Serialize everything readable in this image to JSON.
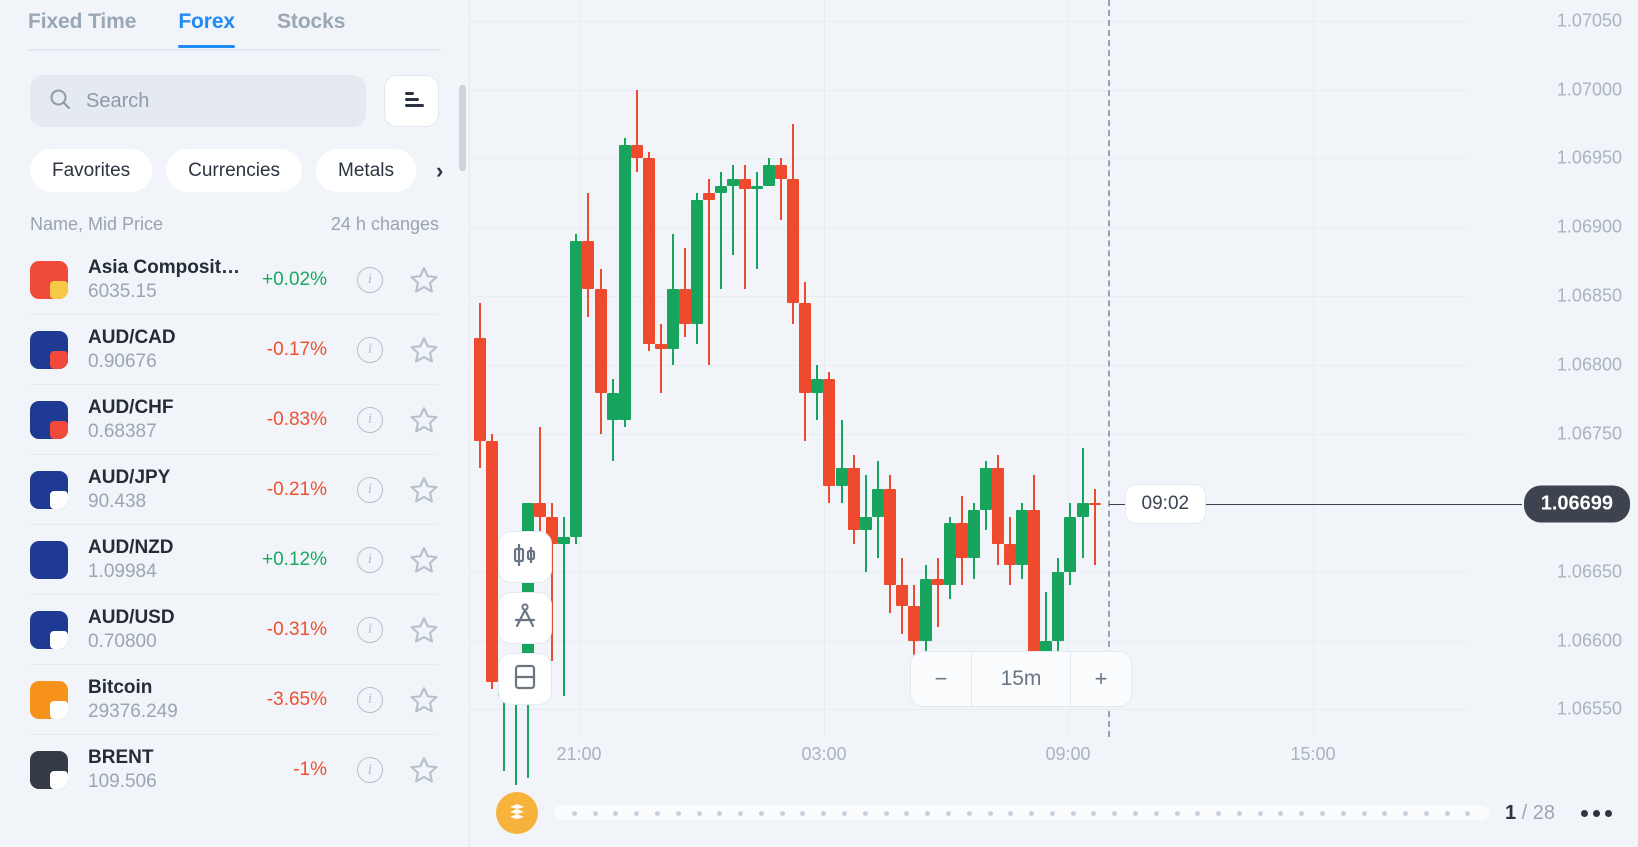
{
  "sidebar": {
    "tabs": [
      {
        "label": "Fixed Time",
        "active": false
      },
      {
        "label": "Forex",
        "active": true
      },
      {
        "label": "Stocks",
        "active": false
      }
    ],
    "search": {
      "placeholder": "Search",
      "value": ""
    },
    "filter_button_icon": "sort-icon",
    "chips": [
      "Favorites",
      "Currencies",
      "Metals"
    ],
    "chips_next_glyph": "›",
    "list_header": {
      "left": "Name, Mid Price",
      "right": "24 h changes"
    },
    "assets": [
      {
        "name": "Asia Composite In...",
        "price": "6035.15",
        "change": "+0.02%",
        "dir": "up",
        "icon": "flag-asean",
        "c1": "#ef4a3c",
        "c2": "#f7c948"
      },
      {
        "name": "AUD/CAD",
        "price": "0.90676",
        "change": "-0.17%",
        "dir": "down",
        "icon": "flag-aud-cad",
        "c1": "#1f3a93",
        "c2": "#ef4a3c"
      },
      {
        "name": "AUD/CHF",
        "price": "0.68387",
        "change": "-0.83%",
        "dir": "down",
        "icon": "flag-aud-chf",
        "c1": "#1f3a93",
        "c2": "#ef4a3c"
      },
      {
        "name": "AUD/JPY",
        "price": "90.438",
        "change": "-0.21%",
        "dir": "down",
        "icon": "flag-aud-jpy",
        "c1": "#1f3a93",
        "c2": "#ffffff"
      },
      {
        "name": "AUD/NZD",
        "price": "1.09984",
        "change": "+0.12%",
        "dir": "up",
        "icon": "flag-aud-nzd",
        "c1": "#1f3a93",
        "c2": "#1f3a93"
      },
      {
        "name": "AUD/USD",
        "price": "0.70800",
        "change": "-0.31%",
        "dir": "down",
        "icon": "flag-aud-usd",
        "c1": "#1f3a93",
        "c2": "#ffffff"
      },
      {
        "name": "Bitcoin",
        "price": "29376.249",
        "change": "-3.65%",
        "dir": "down",
        "icon": "bitcoin-icon",
        "c1": "#f7931a",
        "c2": "#ffffff"
      },
      {
        "name": "BRENT",
        "price": "109.506",
        "change": "-1%",
        "dir": "down",
        "icon": "oil-drop-icon",
        "c1": "#343a46",
        "c2": "#ffffff"
      }
    ],
    "info_glyph": "i",
    "star_icon": "star-outline-icon"
  },
  "chart": {
    "toolbar": [
      {
        "name": "candlestick-type-button",
        "icon": "candlestick-icon"
      },
      {
        "name": "drawing-tools-button",
        "icon": "compass-icon"
      },
      {
        "name": "indicators-button",
        "icon": "panel-split-icon"
      }
    ],
    "timeframe": {
      "minus": "−",
      "value": "15m",
      "plus": "+"
    },
    "crosshair_time": "09:02",
    "current_price": "1.06699",
    "y_axis_labels": [
      "1.07050",
      "1.07000",
      "1.06950",
      "1.06900",
      "1.06850",
      "1.06800",
      "1.06750",
      "1.06650",
      "1.06600",
      "1.06550"
    ],
    "x_axis_labels": [
      "21:00",
      "03:00",
      "09:00",
      "15:00"
    ],
    "pagination": {
      "current": "1",
      "separator": "/",
      "total": "28"
    },
    "more_icon": "more-dots-icon",
    "logo_icon": "brand-logo-icon",
    "colors": {
      "up": "#17a55e",
      "down": "#ef4a2e",
      "accent": "#1f8cf5",
      "tag_bg": "#3d434f",
      "brand": "#f7b23b"
    }
  },
  "chart_data": {
    "type": "candlestick",
    "title": "",
    "xlabel": "",
    "ylabel": "",
    "ylim": [
      1.0653,
      1.07065
    ],
    "xticks": [
      "21:00",
      "03:00",
      "09:00",
      "15:00"
    ],
    "yticks": [
      1.0705,
      1.07,
      1.0695,
      1.069,
      1.0685,
      1.068,
      1.0675,
      1.0665,
      1.066,
      1.0655
    ],
    "grid": true,
    "legend": "none",
    "current_price": 1.06699,
    "crosshair_time": "09:02",
    "candles": [
      {
        "o": 1.0682,
        "h": 1.06845,
        "l": 1.06725,
        "c": 1.06745,
        "d": "down"
      },
      {
        "o": 1.06745,
        "h": 1.0675,
        "l": 1.06565,
        "c": 1.0657,
        "d": "down"
      },
      {
        "o": 1.06565,
        "h": 1.06575,
        "l": 1.06505,
        "c": 1.0656,
        "d": "up"
      },
      {
        "o": 1.0656,
        "h": 1.0658,
        "l": 1.06495,
        "c": 1.06572,
        "d": "up"
      },
      {
        "o": 1.06572,
        "h": 1.067,
        "l": 1.065,
        "c": 1.067,
        "d": "up"
      },
      {
        "o": 1.067,
        "h": 1.06755,
        "l": 1.06665,
        "c": 1.0669,
        "d": "down"
      },
      {
        "o": 1.0669,
        "h": 1.067,
        "l": 1.06585,
        "c": 1.0667,
        "d": "down"
      },
      {
        "o": 1.0667,
        "h": 1.0669,
        "l": 1.0656,
        "c": 1.06675,
        "d": "up"
      },
      {
        "o": 1.06675,
        "h": 1.06895,
        "l": 1.0667,
        "c": 1.0689,
        "d": "up"
      },
      {
        "o": 1.0689,
        "h": 1.06925,
        "l": 1.06835,
        "c": 1.06855,
        "d": "down"
      },
      {
        "o": 1.06855,
        "h": 1.0687,
        "l": 1.0675,
        "c": 1.0678,
        "d": "down"
      },
      {
        "o": 1.0678,
        "h": 1.0679,
        "l": 1.0673,
        "c": 1.0676,
        "d": "up"
      },
      {
        "o": 1.0676,
        "h": 1.06965,
        "l": 1.06755,
        "c": 1.0696,
        "d": "up"
      },
      {
        "o": 1.0696,
        "h": 1.07,
        "l": 1.0694,
        "c": 1.0695,
        "d": "down"
      },
      {
        "o": 1.0695,
        "h": 1.06955,
        "l": 1.0681,
        "c": 1.06815,
        "d": "down"
      },
      {
        "o": 1.06815,
        "h": 1.0683,
        "l": 1.0678,
        "c": 1.06812,
        "d": "down"
      },
      {
        "o": 1.06812,
        "h": 1.06895,
        "l": 1.068,
        "c": 1.06855,
        "d": "up"
      },
      {
        "o": 1.06855,
        "h": 1.06885,
        "l": 1.0682,
        "c": 1.0683,
        "d": "down"
      },
      {
        "o": 1.0683,
        "h": 1.06925,
        "l": 1.06815,
        "c": 1.0692,
        "d": "up"
      },
      {
        "o": 1.0692,
        "h": 1.06935,
        "l": 1.068,
        "c": 1.06925,
        "d": "down"
      },
      {
        "o": 1.06925,
        "h": 1.0694,
        "l": 1.06855,
        "c": 1.0693,
        "d": "up"
      },
      {
        "o": 1.0693,
        "h": 1.06945,
        "l": 1.0688,
        "c": 1.06935,
        "d": "up"
      },
      {
        "o": 1.06935,
        "h": 1.06945,
        "l": 1.06855,
        "c": 1.06928,
        "d": "down"
      },
      {
        "o": 1.06928,
        "h": 1.0694,
        "l": 1.0687,
        "c": 1.0693,
        "d": "up"
      },
      {
        "o": 1.0693,
        "h": 1.0695,
        "l": 1.0693,
        "c": 1.06945,
        "d": "up"
      },
      {
        "o": 1.06945,
        "h": 1.0695,
        "l": 1.06905,
        "c": 1.06935,
        "d": "down"
      },
      {
        "o": 1.06935,
        "h": 1.06975,
        "l": 1.0683,
        "c": 1.06845,
        "d": "down"
      },
      {
        "o": 1.06845,
        "h": 1.0686,
        "l": 1.06745,
        "c": 1.0678,
        "d": "down"
      },
      {
        "o": 1.0678,
        "h": 1.068,
        "l": 1.0676,
        "c": 1.0679,
        "d": "up"
      },
      {
        "o": 1.0679,
        "h": 1.06795,
        "l": 1.067,
        "c": 1.06712,
        "d": "down"
      },
      {
        "o": 1.06712,
        "h": 1.0676,
        "l": 1.067,
        "c": 1.06725,
        "d": "up"
      },
      {
        "o": 1.06725,
        "h": 1.06735,
        "l": 1.0667,
        "c": 1.0668,
        "d": "down"
      },
      {
        "o": 1.0668,
        "h": 1.0672,
        "l": 1.0665,
        "c": 1.0669,
        "d": "up"
      },
      {
        "o": 1.0669,
        "h": 1.0673,
        "l": 1.0666,
        "c": 1.0671,
        "d": "up"
      },
      {
        "o": 1.0671,
        "h": 1.0672,
        "l": 1.0662,
        "c": 1.0664,
        "d": "down"
      },
      {
        "o": 1.0664,
        "h": 1.0666,
        "l": 1.06605,
        "c": 1.06625,
        "d": "down"
      },
      {
        "o": 1.06625,
        "h": 1.0664,
        "l": 1.0658,
        "c": 1.066,
        "d": "down"
      },
      {
        "o": 1.066,
        "h": 1.06655,
        "l": 1.06585,
        "c": 1.06645,
        "d": "up"
      },
      {
        "o": 1.06645,
        "h": 1.0666,
        "l": 1.0661,
        "c": 1.0664,
        "d": "down"
      },
      {
        "o": 1.0664,
        "h": 1.0669,
        "l": 1.0663,
        "c": 1.06685,
        "d": "up"
      },
      {
        "o": 1.06685,
        "h": 1.06705,
        "l": 1.0664,
        "c": 1.0666,
        "d": "down"
      },
      {
        "o": 1.0666,
        "h": 1.067,
        "l": 1.06645,
        "c": 1.06695,
        "d": "up"
      },
      {
        "o": 1.06695,
        "h": 1.0673,
        "l": 1.0668,
        "c": 1.06725,
        "d": "up"
      },
      {
        "o": 1.06725,
        "h": 1.06735,
        "l": 1.06655,
        "c": 1.0667,
        "d": "down"
      },
      {
        "o": 1.0667,
        "h": 1.0669,
        "l": 1.0664,
        "c": 1.06655,
        "d": "down"
      },
      {
        "o": 1.06655,
        "h": 1.067,
        "l": 1.06645,
        "c": 1.06695,
        "d": "up"
      },
      {
        "o": 1.06695,
        "h": 1.0672,
        "l": 1.0658,
        "c": 1.0659,
        "d": "down"
      },
      {
        "o": 1.0659,
        "h": 1.06635,
        "l": 1.0657,
        "c": 1.066,
        "d": "up"
      },
      {
        "o": 1.066,
        "h": 1.0666,
        "l": 1.06575,
        "c": 1.0665,
        "d": "up"
      },
      {
        "o": 1.0665,
        "h": 1.067,
        "l": 1.0664,
        "c": 1.0669,
        "d": "up"
      },
      {
        "o": 1.0669,
        "h": 1.0674,
        "l": 1.0666,
        "c": 1.067,
        "d": "up"
      },
      {
        "o": 1.067,
        "h": 1.0671,
        "l": 1.06655,
        "c": 1.06699,
        "d": "down"
      }
    ]
  }
}
